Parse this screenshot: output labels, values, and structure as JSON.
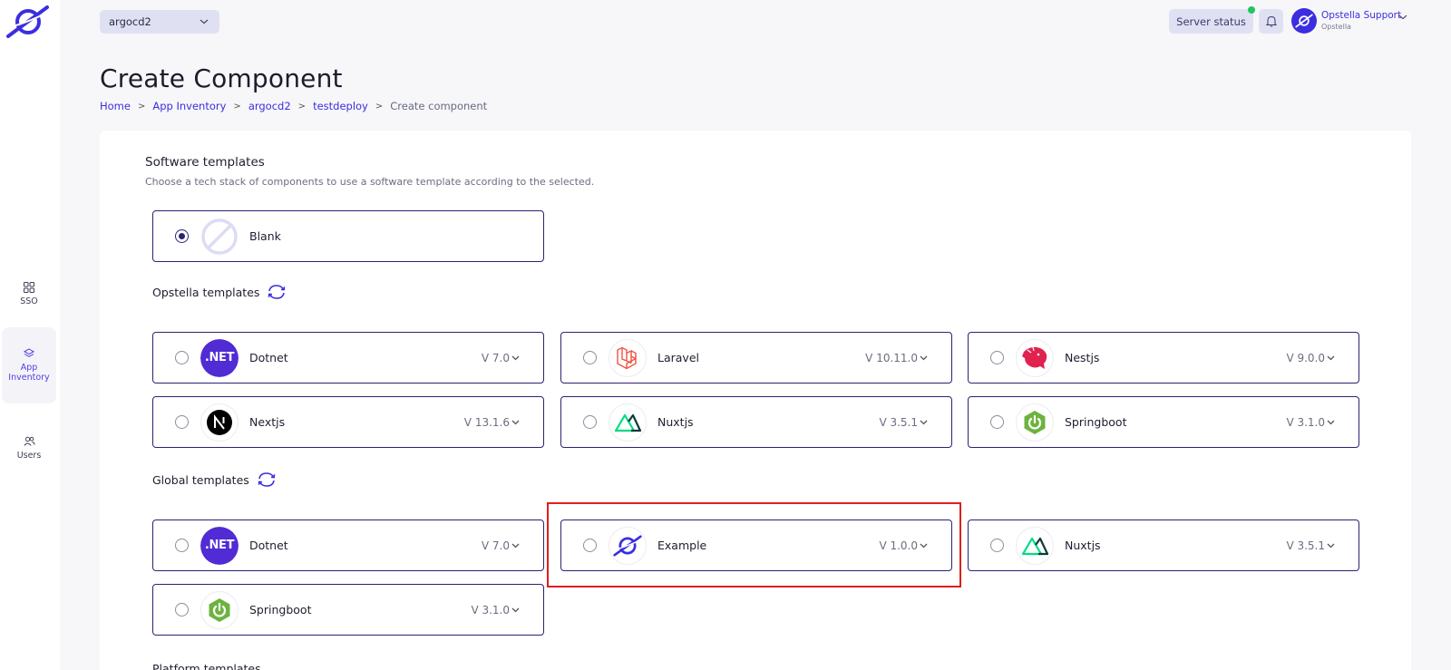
{
  "header": {
    "project_select": "argocd2",
    "server_status": "Server status",
    "user": {
      "name": "Opstella Support",
      "org": "Opstella"
    }
  },
  "sidebar": {
    "items": [
      {
        "label": "SSO",
        "icon": "grid-icon",
        "active": false
      },
      {
        "label": "App Inventory",
        "icon": "layers-icon",
        "active": true
      },
      {
        "label": "Users",
        "icon": "users-icon",
        "active": false
      }
    ]
  },
  "page": {
    "title": "Create Component",
    "breadcrumb": [
      "Home",
      "App Inventory",
      "argocd2",
      "testdeploy"
    ],
    "breadcrumb_current": "Create component"
  },
  "software_templates": {
    "title": "Software templates",
    "description": "Choose a tech stack of components to use a software template according to the selected.",
    "blank": {
      "name": "Blank",
      "selected": true
    }
  },
  "opstella_templates": {
    "label": "Opstella templates",
    "items": [
      {
        "name": "Dotnet",
        "version": "V 7.0",
        "icon": "dotnet-icon"
      },
      {
        "name": "Laravel",
        "version": "V 10.11.0",
        "icon": "laravel-icon"
      },
      {
        "name": "Nestjs",
        "version": "V 9.0.0",
        "icon": "nestjs-icon"
      },
      {
        "name": "Nextjs",
        "version": "V 13.1.6",
        "icon": "nextjs-icon"
      },
      {
        "name": "Nuxtjs",
        "version": "V 3.5.1",
        "icon": "nuxtjs-icon"
      },
      {
        "name": "Springboot",
        "version": "V 3.1.0",
        "icon": "springboot-icon"
      }
    ]
  },
  "global_templates": {
    "label": "Global templates",
    "items": [
      {
        "name": "Dotnet",
        "version": "V 7.0",
        "icon": "dotnet-icon"
      },
      {
        "name": "Example",
        "version": "V 1.0.0",
        "icon": "opstella-icon"
      },
      {
        "name": "Nuxtjs",
        "version": "V 3.5.1",
        "icon": "nuxtjs-icon"
      },
      {
        "name": "Springboot",
        "version": "V 3.1.0",
        "icon": "springboot-icon"
      }
    ]
  },
  "platform_templates": {
    "label": "Platform templates"
  },
  "colors": {
    "accent": "#3b2ee0",
    "border": "#2a2372",
    "highlight": "#e11d1d",
    "dotnet": "#512bd4"
  }
}
